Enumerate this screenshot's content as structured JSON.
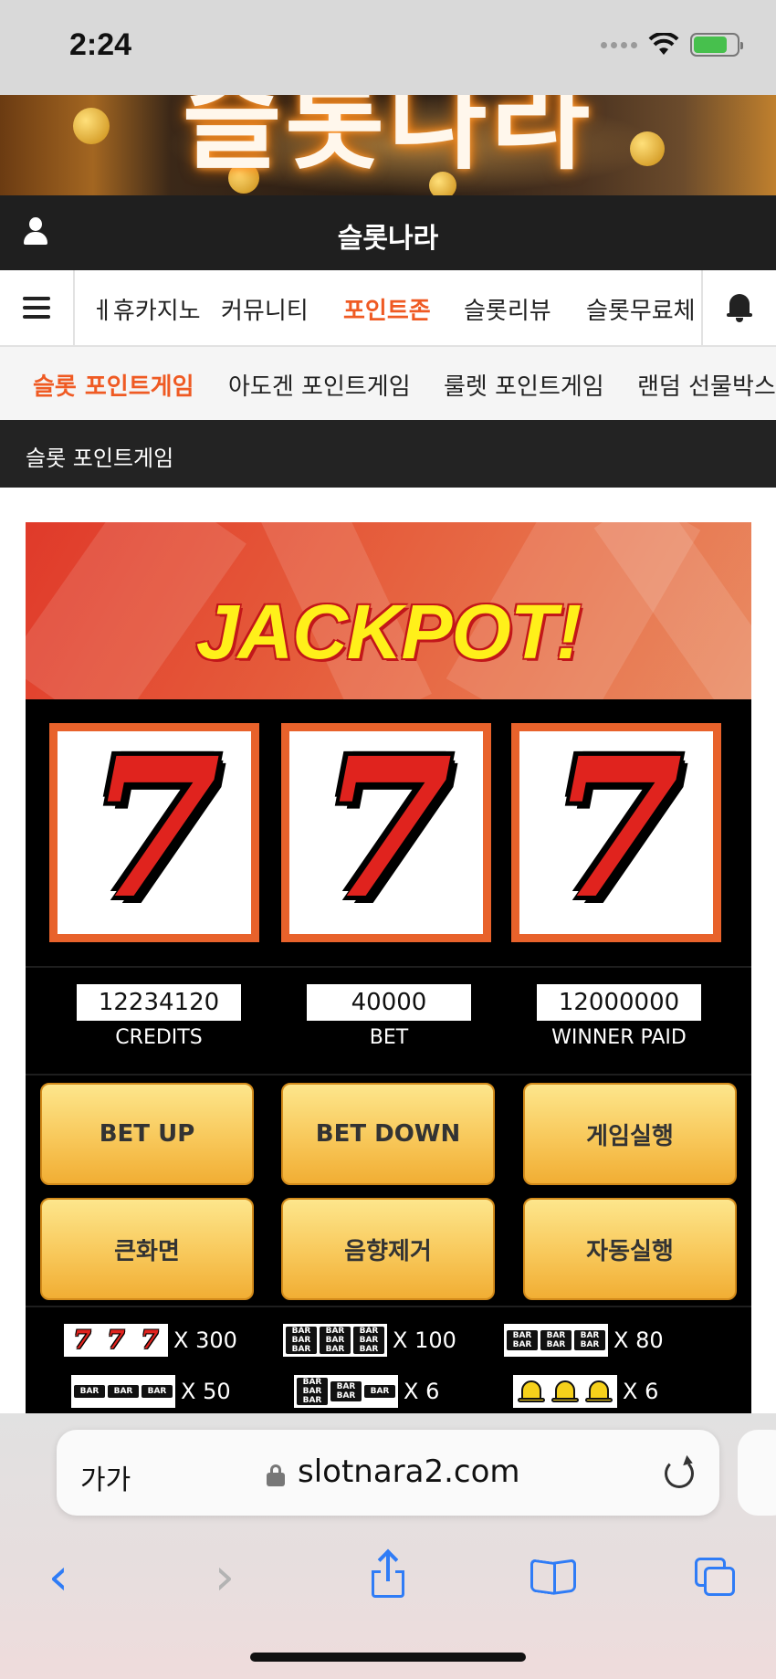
{
  "status_bar": {
    "time": "2:24",
    "icons": [
      "signal-icon",
      "wifi-icon",
      "battery-charging-icon"
    ]
  },
  "banner": {
    "title": "슬롯나라"
  },
  "header": {
    "title": "슬롯나라",
    "icon": "user-icon"
  },
  "main_nav": {
    "items": [
      {
        "label": "ㅔ휴카지노",
        "active": false
      },
      {
        "label": "커뮤니티",
        "active": false
      },
      {
        "label": "포인트존",
        "active": true
      },
      {
        "label": "슬롯리뷰",
        "active": false
      },
      {
        "label": "슬롯무료체",
        "active": false
      }
    ],
    "accent_color": "#ef5a23"
  },
  "sub_nav": {
    "items": [
      {
        "label": "슬롯 포인트게임",
        "active": true
      },
      {
        "label": "아도겐 포인트게임",
        "active": false
      },
      {
        "label": "룰렛 포인트게임",
        "active": false
      },
      {
        "label": "랜덤 선물박스",
        "active": false
      }
    ]
  },
  "section": {
    "title": "슬롯 포인트게임"
  },
  "slot": {
    "jackpot_text": "JACKPOT!",
    "reels": [
      "7",
      "7",
      "7"
    ],
    "stats": {
      "credits_value": "12234120",
      "credits_label": "CREDITS",
      "bet_value": "40000",
      "bet_label": "BET",
      "winner_value": "12000000",
      "winner_label": "WINNER PAID"
    },
    "buttons": {
      "bet_up": "BET UP",
      "bet_down": "BET DOWN",
      "play": "게임실행",
      "fullscreen": "큰화면",
      "mute": "음향제거",
      "auto_play": "자동실행"
    },
    "paytable": [
      {
        "symbols": "seven",
        "multiplier": "X 300"
      },
      {
        "symbols": "triple-bar",
        "multiplier": "X 100"
      },
      {
        "symbols": "double-bar",
        "multiplier": "X 80"
      },
      {
        "symbols": "single-bar",
        "multiplier": "X 50"
      },
      {
        "symbols": "mixed-bar",
        "multiplier": "X 6"
      },
      {
        "symbols": "bell",
        "multiplier": "X 6"
      }
    ],
    "bar_text": "BAR"
  },
  "browser": {
    "text_size_label": "가가",
    "url": "slotnara2.com",
    "link_color": "#2f7cf6"
  }
}
